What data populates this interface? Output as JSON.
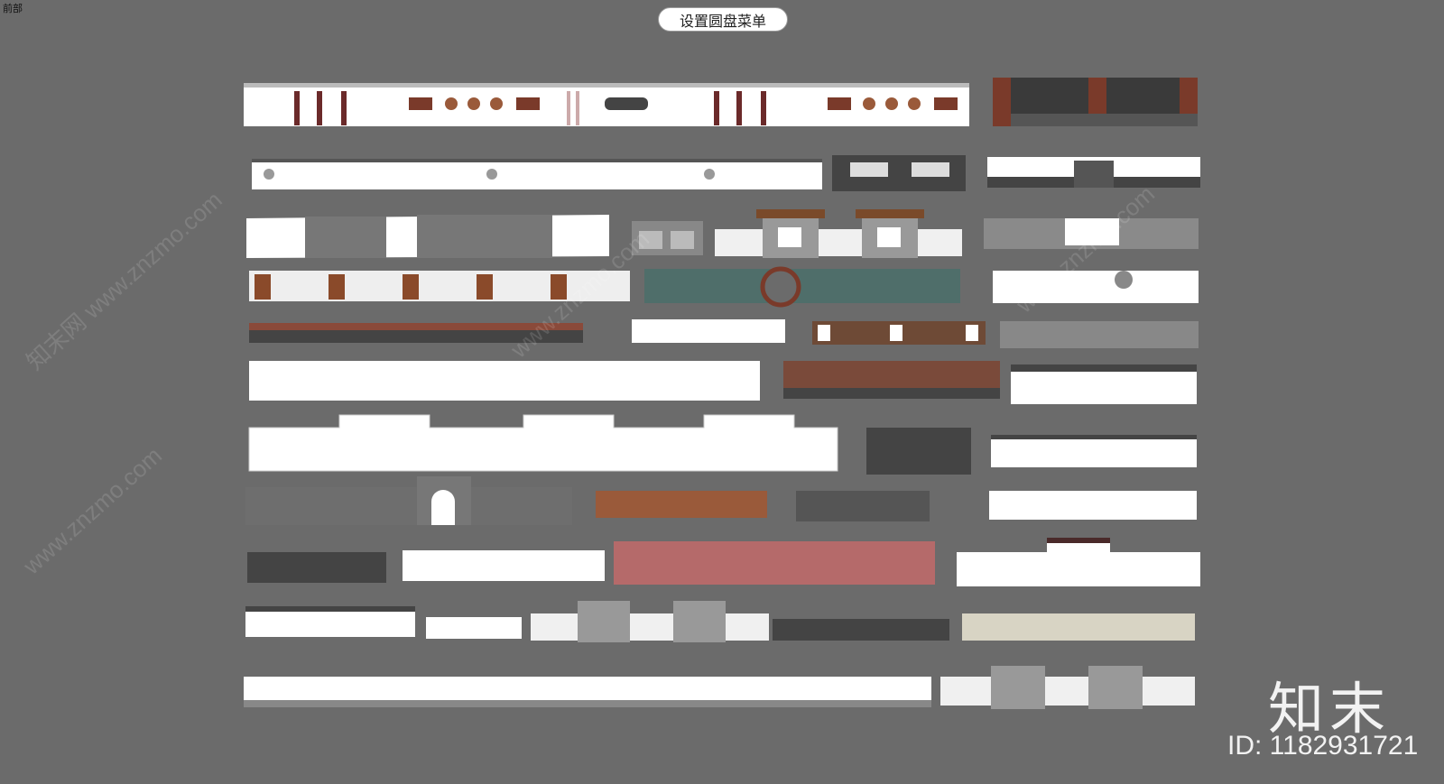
{
  "viewport": {
    "view_label": "前部"
  },
  "pie_menu_button": {
    "label": "设置圆盘菜单"
  },
  "watermarks": {
    "site": "www.znzmo.com",
    "site_cn": "知末网 www.znzmo.com"
  },
  "brand": {
    "logo_text": "知末",
    "id_text": "ID: 1182931721"
  },
  "colors": {
    "background": "#6b6b6b",
    "wall_white": "#ffffff",
    "wall_gray": "#4a4a4a",
    "brick_red": "#8a4a3a",
    "roof_wood": "#9a5a3a",
    "teal_wall": "#4f6e6a"
  },
  "icons": {
    "logo": "zhimo-logo"
  }
}
